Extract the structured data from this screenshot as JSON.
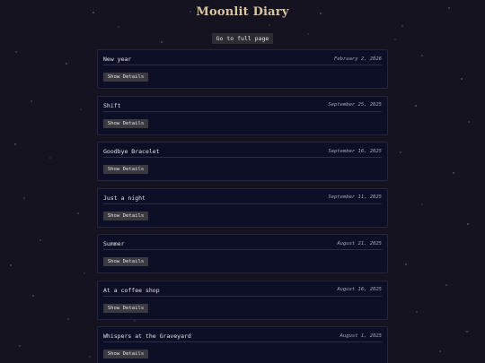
{
  "header": {
    "title": "Moonlit Diary",
    "full_page_label": "Go to full page"
  },
  "entries": [
    {
      "title": "New year",
      "date": "February 2, 2026",
      "button_label": "Show Details"
    },
    {
      "title": "Shift",
      "date": "September 25, 2025",
      "button_label": "Show Details"
    },
    {
      "title": "Goodbye Bracelet",
      "date": "September 16, 2025",
      "button_label": "Show Details"
    },
    {
      "title": "Just a night",
      "date": "September 11, 2025",
      "button_label": "Show Details"
    },
    {
      "title": "Summer",
      "date": "August 21, 2025",
      "button_label": "Show Details"
    },
    {
      "title": "At a coffee shop",
      "date": "August 16, 2025",
      "button_label": "Show Details"
    },
    {
      "title": "Whispers at the Graveyard",
      "date": "August 1, 2025",
      "button_label": "Show Details"
    }
  ],
  "colors": {
    "background": "#14131f",
    "card_background": "#0d0f26",
    "title_accent": "#d9c3a1",
    "button": "#3a3a40"
  }
}
